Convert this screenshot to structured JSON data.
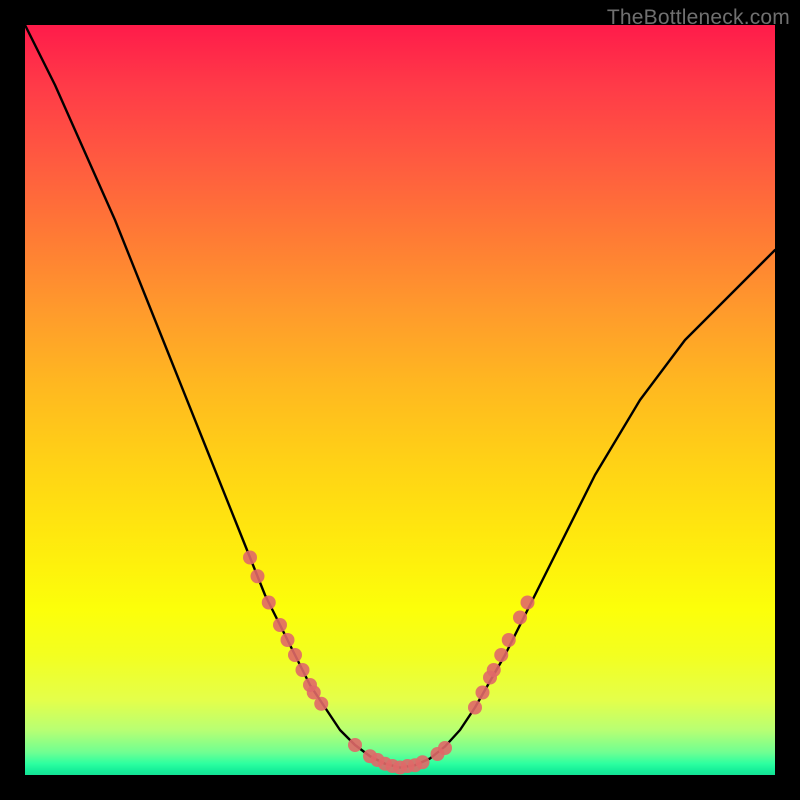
{
  "watermark": "TheBottleneck.com",
  "chart_data": {
    "type": "line",
    "title": "",
    "xlabel": "",
    "ylabel": "",
    "xlim": [
      0,
      100
    ],
    "ylim": [
      0,
      100
    ],
    "grid": false,
    "legend": false,
    "series": [
      {
        "name": "curve",
        "x": [
          0,
          4,
          8,
          12,
          16,
          20,
          24,
          28,
          30,
          32,
          34,
          36,
          38,
          40,
          42,
          44,
          46,
          48,
          50,
          52,
          54,
          56,
          58,
          60,
          64,
          70,
          76,
          82,
          88,
          94,
          100
        ],
        "y": [
          100,
          92,
          83,
          74,
          64,
          54,
          44,
          34,
          29,
          24,
          20,
          16,
          12,
          9,
          6,
          4,
          2.5,
          1.5,
          1,
          1.3,
          2.2,
          3.8,
          6,
          9,
          16,
          28,
          40,
          50,
          58,
          64,
          70
        ]
      }
    ],
    "markers": {
      "left_cluster": [
        {
          "x": 30,
          "y": 29
        },
        {
          "x": 31,
          "y": 26.5
        },
        {
          "x": 32.5,
          "y": 23
        },
        {
          "x": 34,
          "y": 20
        },
        {
          "x": 35,
          "y": 18
        },
        {
          "x": 36,
          "y": 16
        },
        {
          "x": 37,
          "y": 14
        },
        {
          "x": 38,
          "y": 12
        },
        {
          "x": 38.5,
          "y": 11
        },
        {
          "x": 39.5,
          "y": 9.5
        }
      ],
      "bottom_cluster": [
        {
          "x": 44,
          "y": 4
        },
        {
          "x": 46,
          "y": 2.5
        },
        {
          "x": 47,
          "y": 2
        },
        {
          "x": 48,
          "y": 1.5
        },
        {
          "x": 49,
          "y": 1.2
        },
        {
          "x": 50,
          "y": 1
        },
        {
          "x": 51,
          "y": 1.2
        },
        {
          "x": 52,
          "y": 1.3
        },
        {
          "x": 53,
          "y": 1.7
        },
        {
          "x": 55,
          "y": 2.8
        },
        {
          "x": 56,
          "y": 3.6
        }
      ],
      "right_cluster": [
        {
          "x": 60,
          "y": 9
        },
        {
          "x": 61,
          "y": 11
        },
        {
          "x": 62,
          "y": 13
        },
        {
          "x": 62.5,
          "y": 14
        },
        {
          "x": 63.5,
          "y": 16
        },
        {
          "x": 64.5,
          "y": 18
        },
        {
          "x": 66,
          "y": 21
        },
        {
          "x": 67,
          "y": 23
        }
      ]
    },
    "colors": {
      "curve": "#000000",
      "markers": "#e06868",
      "gradient_top": "#ff1b4a",
      "gradient_mid": "#ffe80e",
      "gradient_bottom": "#14e095"
    }
  }
}
